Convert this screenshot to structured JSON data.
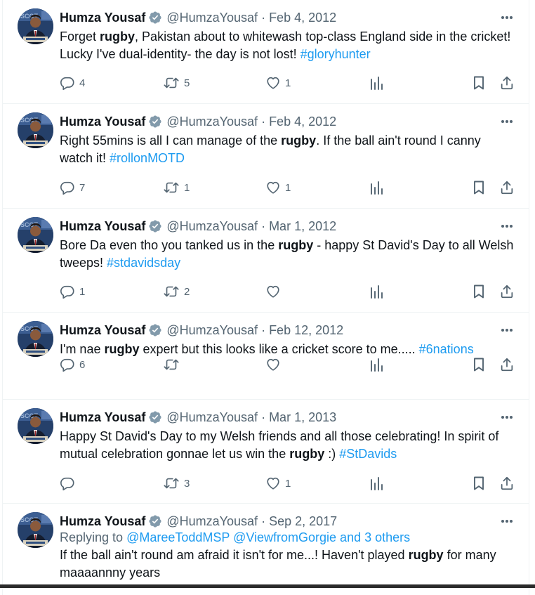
{
  "author": {
    "name": "Humza Yousaf",
    "handle": "@HumzaYousaf"
  },
  "icons": {
    "verified": "verified-badge-icon",
    "more": "more-dots-icon",
    "reply": "reply-icon",
    "retweet": "retweet-icon",
    "like": "like-heart-icon",
    "views": "views-chart-icon",
    "bookmark": "bookmark-icon",
    "share": "share-icon"
  },
  "colors": {
    "link": "#1d9bf0",
    "secondary_text": "#536471",
    "verified": "#829aab"
  },
  "tweets": [
    {
      "date": "Feb 4, 2012",
      "text": [
        {
          "t": "Forget "
        },
        {
          "t": "rugby",
          "b": true
        },
        {
          "t": ", Pakistan about to whitewash top-class England side in the cricket! Lucky I've dual-identity- the day is not lost! "
        },
        {
          "t": "#gloryhunter",
          "h": true
        }
      ],
      "replies": "4",
      "retweets": "5",
      "likes": "1"
    },
    {
      "date": "Feb 4, 2012",
      "text": [
        {
          "t": "Right 55mins is all I can manage of the "
        },
        {
          "t": "rugby",
          "b": true
        },
        {
          "t": ". If the ball ain't round I canny watch it! "
        },
        {
          "t": "#rollonMOTD",
          "h": true
        }
      ],
      "replies": "7",
      "retweets": "1",
      "likes": "1"
    },
    {
      "date": "Mar 1, 2012",
      "text": [
        {
          "t": "Bore Da even tho you tanked us in the "
        },
        {
          "t": "rugby",
          "b": true
        },
        {
          "t": " - happy St David's Day to all Welsh tweeps! "
        },
        {
          "t": "#stdavidsday",
          "h": true
        }
      ],
      "replies": "1",
      "retweets": "2",
      "likes": ""
    },
    {
      "date": "Feb 12, 2012",
      "text": [
        {
          "t": "I'm nae "
        },
        {
          "t": "rugby",
          "b": true
        },
        {
          "t": " expert but this looks like a cricket score to me..... "
        },
        {
          "t": "#6nations",
          "h": true
        }
      ],
      "replies": "6",
      "retweets": "",
      "likes": ""
    },
    {
      "date": "Mar 1, 2013",
      "text": [
        {
          "t": "Happy St David's Day to my Welsh friends and all those celebrating! In spirit of mutual celebration gonnae let us win the "
        },
        {
          "t": "rugby",
          "b": true
        },
        {
          "t": " :) "
        },
        {
          "t": "#StDavids",
          "h": true
        }
      ],
      "replies": "",
      "retweets": "3",
      "likes": "1"
    },
    {
      "date": "Sep 2, 2017",
      "replying_prefix": "Replying to ",
      "replying_to": "@MareeToddMSP @ViewfromGorgie and 3 others",
      "text": [
        {
          "t": "If the ball ain't round am afraid it isn't for me...! Haven't played "
        },
        {
          "t": "rugby",
          "b": true
        },
        {
          "t": " for many maaaannny years"
        }
      ]
    }
  ]
}
